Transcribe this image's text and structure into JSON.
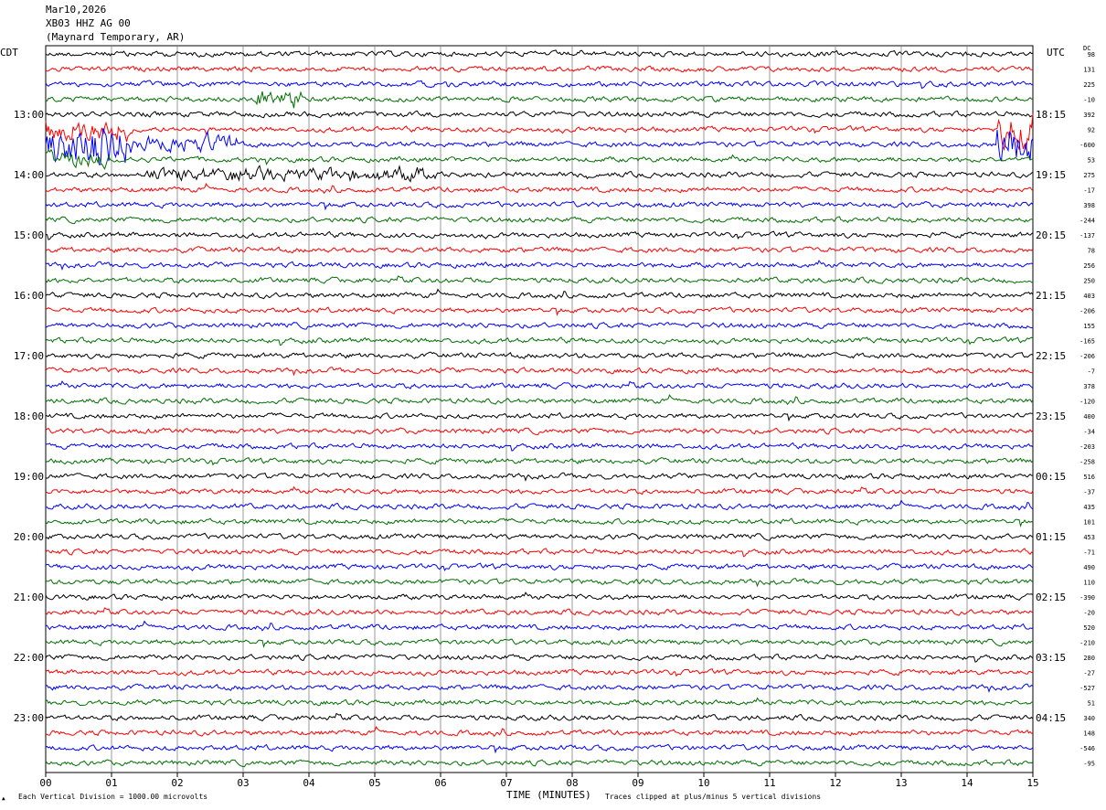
{
  "header": {
    "date": "Mar10,2026",
    "station": "XB03 HHZ AG 00",
    "location": "(Maynard Temporary, AR)"
  },
  "left_axis_label": "CDT",
  "right_axis_label": "UTC",
  "dc_label": "DC",
  "footer": {
    "scale_note": "Each Vertical Division = 1000.00 microvolts",
    "xlabel": "TIME (MINUTES)",
    "clip_note": "Traces clipped at plus/minus 5 vertical divisions"
  },
  "colors": {
    "trace_cycle": [
      "#000000",
      "#ff0000",
      "#0000ff",
      "#007000"
    ],
    "grid": "#808080",
    "frame": "#000000"
  },
  "chart_data": {
    "type": "line",
    "title": "XB03 HHZ AG 00",
    "xlabel": "TIME (MINUTES)",
    "xlim": [
      0,
      15
    ],
    "x_ticks": [
      "00",
      "01",
      "02",
      "03",
      "04",
      "05",
      "06",
      "07",
      "08",
      "09",
      "10",
      "11",
      "12",
      "13",
      "14",
      "15"
    ],
    "trace_count": 48,
    "traces_per_hour": 4,
    "minutes_per_trace": 15,
    "grid": true,
    "left_time_labels": [
      "13:00",
      "14:00",
      "15:00",
      "16:00",
      "17:00",
      "18:00",
      "19:00",
      "20:00",
      "21:00",
      "22:00",
      "23:00"
    ],
    "right_time_labels": [
      "18:15",
      "19:15",
      "20:15",
      "21:15",
      "22:15",
      "23:15",
      "00:15",
      "01:15",
      "02:15",
      "03:15",
      "04:15"
    ],
    "dc_offsets": [
      "98",
      "131",
      "225",
      "-10",
      "392",
      "92",
      "-600",
      "53",
      "275",
      "-17",
      "398",
      "-244",
      "-137",
      "78",
      "256",
      "250",
      "403",
      "-206",
      "155",
      "-165",
      "-206",
      "-7",
      "378",
      "-120",
      "400",
      "-34",
      "-203",
      "-258",
      "516",
      "-37",
      "435",
      "101",
      "453",
      "-71",
      "490",
      "110",
      "-390",
      "-20",
      "520",
      "-210",
      "280",
      "-27",
      "-527",
      "51",
      "340",
      "148",
      "-546",
      "-95"
    ],
    "amplitude_scale_microvolts_per_division": 1000.0,
    "clip_divisions": 5
  }
}
